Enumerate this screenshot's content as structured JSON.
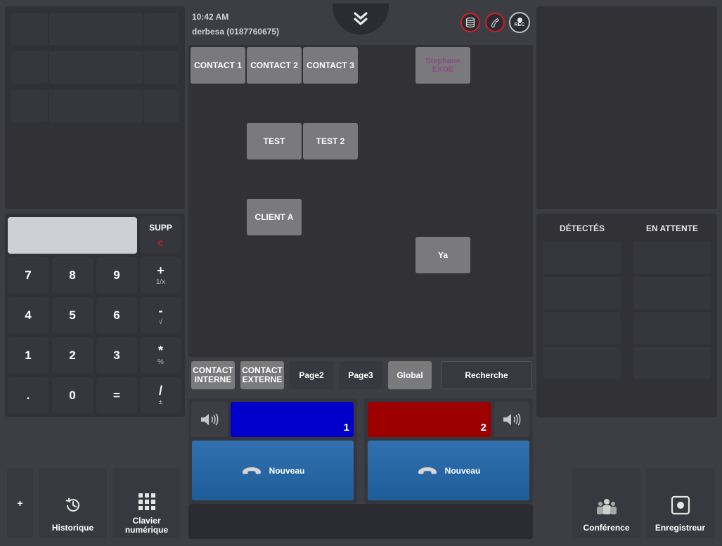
{
  "header": {
    "time": "10:42 AM",
    "user": "derbesa (0187760675)",
    "rec_label": "REC"
  },
  "contacts": {
    "c1": "CONTACT 1",
    "c2": "CONTACT 2",
    "c3": "CONTACT 3",
    "stephane_line1": "Stephane",
    "stephane_line2": "EXOE",
    "test": "TEST",
    "test2": "TEST 2",
    "client_a": "CLIENT A",
    "ya": "Ya"
  },
  "tabs": {
    "contact_interne_l1": "CONTACT",
    "contact_interne_l2": "INTERNE",
    "contact_externe_l1": "CONTACT",
    "contact_externe_l2": "EXTERNE",
    "page2": "Page2",
    "page3": "Page3",
    "global": "Global",
    "recherche": "Recherche"
  },
  "keypad": {
    "supp": "SUPP",
    "supp_sub": "C",
    "k7": "7",
    "k8": "8",
    "k9": "9",
    "plus": "+",
    "plus_sub": "1/x",
    "k4": "4",
    "k5": "5",
    "k6": "6",
    "minus": "-",
    "minus_sub": "√",
    "k1": "1",
    "k2": "2",
    "k3": "3",
    "mult": "*",
    "mult_sub": "%",
    "dot": ".",
    "k0": "0",
    "eq": "=",
    "div": "/",
    "div_sub": "±"
  },
  "lines": {
    "line1_number": "1",
    "line1_color": "#0000cc",
    "line2_number": "2",
    "line2_color": "#9c0000",
    "new_call_label": "Nouveau"
  },
  "right_panel": {
    "detected": "DÉTECTÉS",
    "waiting": "EN ATTENTE"
  },
  "bottom": {
    "plus": "+",
    "history": "Historique",
    "keypad_l1": "Clavier",
    "keypad_l2": "numérique",
    "conference": "Conférence",
    "recorder": "Enregistreur"
  },
  "colors": {
    "accent_red": "#cc1f2b",
    "accent_blue": "#2a6aa8"
  }
}
